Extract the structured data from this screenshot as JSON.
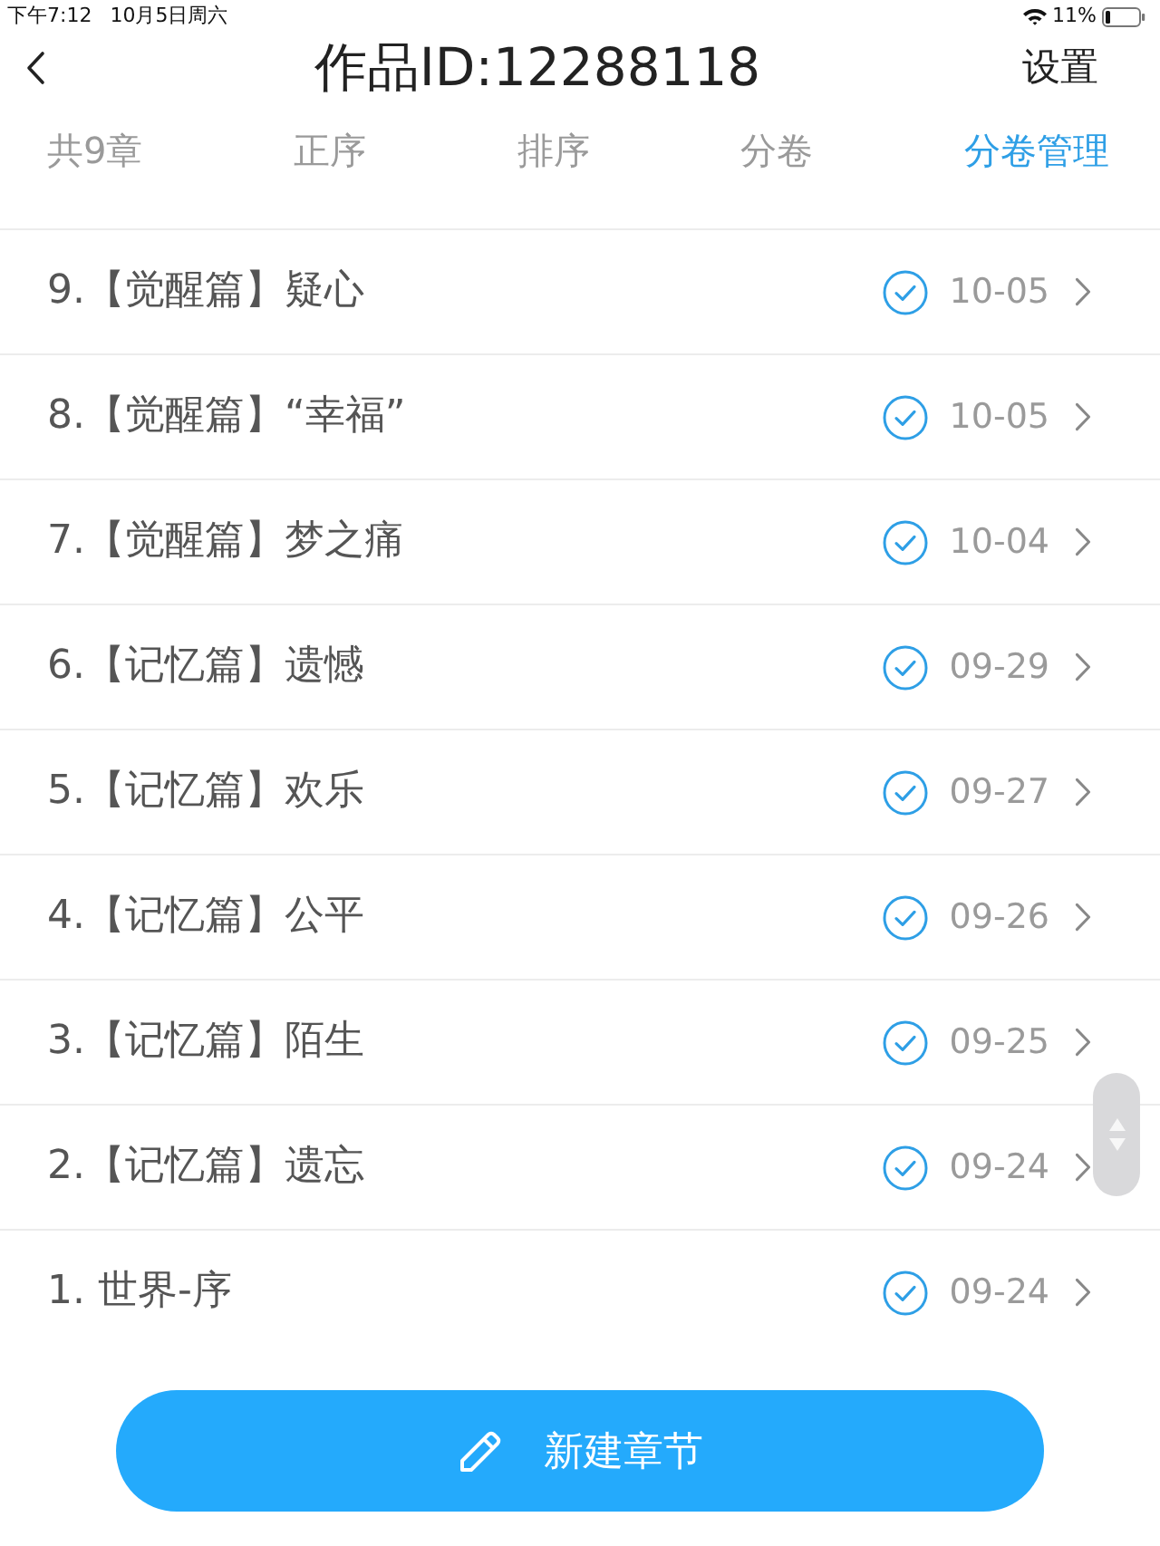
{
  "status_bar": {
    "time": "下午7:12",
    "date": "10月5日周六",
    "battery_text": "11%"
  },
  "nav_bar": {
    "title": "作品ID:12288118",
    "action": "设置"
  },
  "toolbar": {
    "count": "共9章",
    "tabs": [
      {
        "label": "正序",
        "selected": false
      },
      {
        "label": "排序",
        "selected": false
      },
      {
        "label": "分卷",
        "selected": false
      },
      {
        "label": "分卷管理",
        "selected": true
      }
    ]
  },
  "chapters": [
    {
      "title": "9.【觉醒篇】疑心",
      "checked": true,
      "date": "10-05"
    },
    {
      "title": "8.【觉醒篇】“幸福”",
      "checked": true,
      "date": "10-05"
    },
    {
      "title": "7.【觉醒篇】梦之痛",
      "checked": true,
      "date": "10-04"
    },
    {
      "title": "6.【记忆篇】遗憾",
      "checked": true,
      "date": "09-29"
    },
    {
      "title": "5.【记忆篇】欢乐",
      "checked": true,
      "date": "09-27"
    },
    {
      "title": "4.【记忆篇】公平",
      "checked": true,
      "date": "09-26"
    },
    {
      "title": "3.【记忆篇】陌生",
      "checked": true,
      "date": "09-25"
    },
    {
      "title": "2.【记忆篇】遗忘",
      "checked": true,
      "date": "09-24"
    },
    {
      "title": "1. 世界-序",
      "checked": true,
      "date": "09-24"
    }
  ],
  "new_button": {
    "label": "新建章节"
  }
}
